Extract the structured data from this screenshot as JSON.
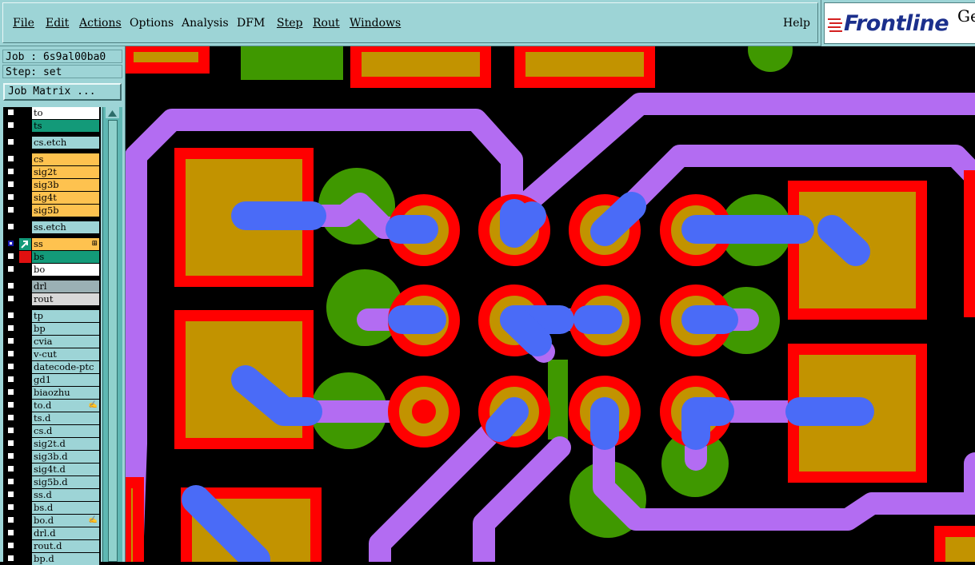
{
  "menubar": {
    "items": [
      "File",
      "Edit",
      "Actions",
      "Options",
      "Analysis",
      "DFM",
      "Step",
      "Rout",
      "Windows"
    ],
    "help": "Help"
  },
  "logo": {
    "text": "Frontline",
    "extra": "Ge"
  },
  "job": {
    "line": "Job : 6s9al00ba0",
    "step": "Step: set",
    "matrix_button": "Job Matrix ..."
  },
  "layers": [
    {
      "name": "to",
      "color": "#ffffff",
      "gap": false
    },
    {
      "name": "ts",
      "color": "#139a79",
      "gap": false
    },
    {
      "name": "cs.etch",
      "color": "#9dd4d6",
      "gap": true
    },
    {
      "name": "cs",
      "color": "#fec24f",
      "gap": true
    },
    {
      "name": "sig2t",
      "color": "#fec24f",
      "gap": false
    },
    {
      "name": "sig3b",
      "color": "#fec24f",
      "gap": false
    },
    {
      "name": "sig4t",
      "color": "#fec24f",
      "gap": false
    },
    {
      "name": "sig5b",
      "color": "#fec24f",
      "gap": false
    },
    {
      "name": "ss.etch",
      "color": "#9dd4d6",
      "gap": true
    },
    {
      "name": "ss",
      "color": "#fec24f",
      "gap": true,
      "selected": true,
      "mid": "cursor",
      "flag": "⊞"
    },
    {
      "name": "bs",
      "color": "#139a79",
      "gap": false,
      "mid": "red"
    },
    {
      "name": "bo",
      "color": "#ffffff",
      "gap": false
    },
    {
      "name": "drl",
      "color": "#9bb0b4",
      "gap": true
    },
    {
      "name": "rout",
      "color": "#d8d8d8",
      "gap": false
    },
    {
      "name": "tp",
      "color": "#9dd4d6",
      "gap": true
    },
    {
      "name": "bp",
      "color": "#9dd4d6",
      "gap": false
    },
    {
      "name": "cvia",
      "color": "#9dd4d6",
      "gap": false
    },
    {
      "name": "v-cut",
      "color": "#9dd4d6",
      "gap": false
    },
    {
      "name": "datecode-ptc",
      "color": "#9dd4d6",
      "gap": false
    },
    {
      "name": "gd1",
      "color": "#9dd4d6",
      "gap": false
    },
    {
      "name": "biaozhu",
      "color": "#9dd4d6",
      "gap": false
    },
    {
      "name": "to.d",
      "color": "#9dd4d6",
      "gap": false,
      "flag": "✍"
    },
    {
      "name": "ts.d",
      "color": "#9dd4d6",
      "gap": false
    },
    {
      "name": "cs.d",
      "color": "#9dd4d6",
      "gap": false
    },
    {
      "name": "sig2t.d",
      "color": "#9dd4d6",
      "gap": false
    },
    {
      "name": "sig3b.d",
      "color": "#9dd4d6",
      "gap": false
    },
    {
      "name": "sig4t.d",
      "color": "#9dd4d6",
      "gap": false
    },
    {
      "name": "sig5b.d",
      "color": "#9dd4d6",
      "gap": false
    },
    {
      "name": "ss.d",
      "color": "#9dd4d6",
      "gap": false
    },
    {
      "name": "bs.d",
      "color": "#9dd4d6",
      "gap": false
    },
    {
      "name": "bo.d",
      "color": "#9dd4d6",
      "gap": false,
      "flag": "✍"
    },
    {
      "name": "drl.d",
      "color": "#9dd4d6",
      "gap": false
    },
    {
      "name": "rout.d",
      "color": "#9dd4d6",
      "gap": false
    },
    {
      "name": "bp.d",
      "color": "#9dd4d6",
      "gap": false
    }
  ],
  "colors": {
    "pad_outline": "#ff0000",
    "pad_fill": "#c29300",
    "ground_fill": "#3f9800",
    "trace_purple": "#b36cf2",
    "trace_blue": "#4a6bf7"
  }
}
